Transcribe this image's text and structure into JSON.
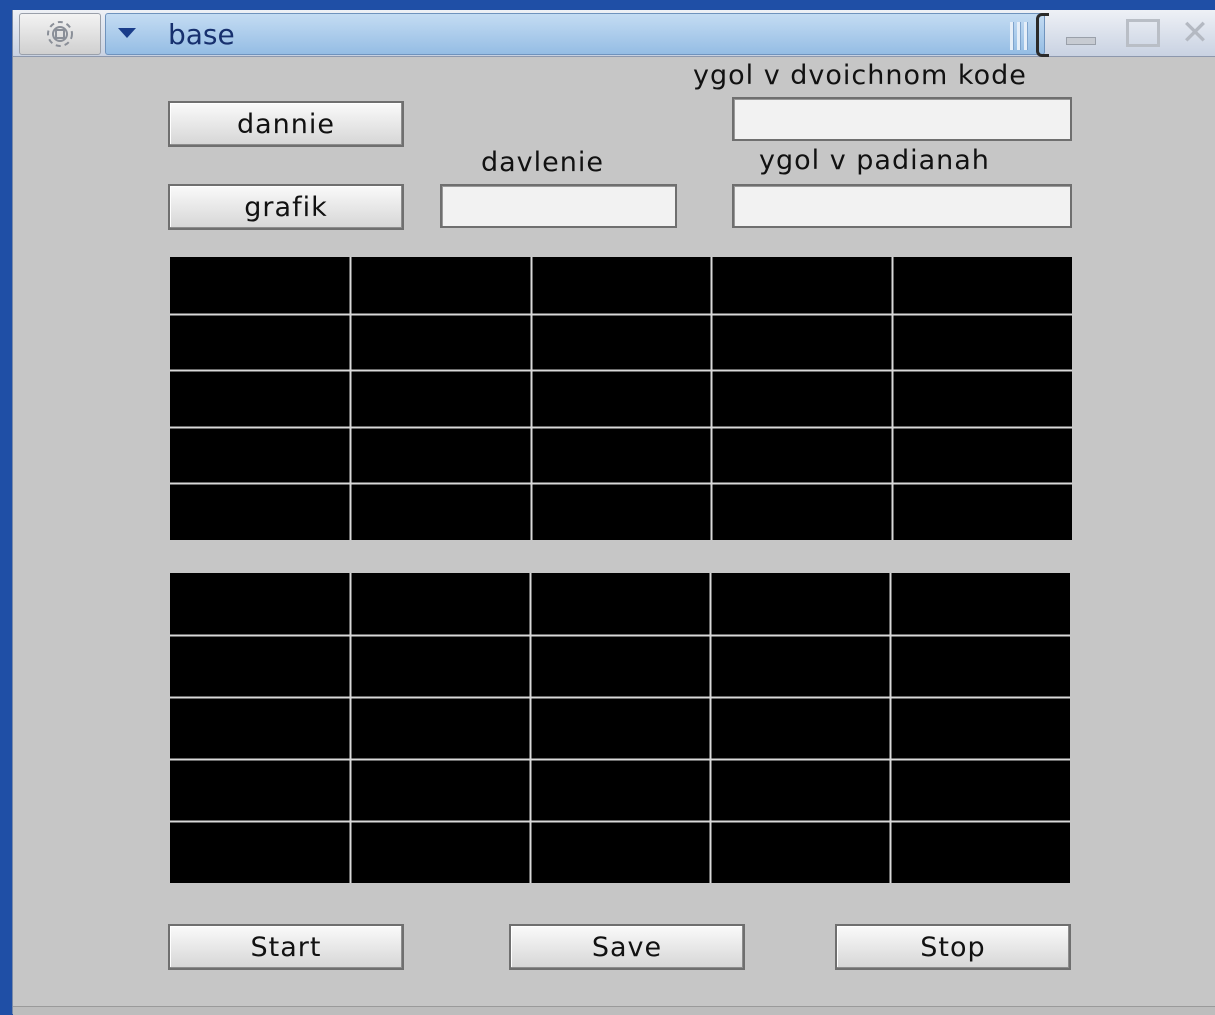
{
  "window": {
    "title": "base",
    "menu_icon": "chevron-down-icon",
    "gear_icon": "gear-icon",
    "controls": [
      "minimize-icon",
      "maximize-icon",
      "close-icon"
    ],
    "close_glyph": "✕"
  },
  "buttons": {
    "dannie": "dannie",
    "grafik": "grafik",
    "start": "Start",
    "save": "Save",
    "stop": "Stop"
  },
  "labels": {
    "binary_angle": "ygol v dvoichnom kode",
    "pressure": "davlenie",
    "radian_angle": "ygol v padianah"
  },
  "fields": {
    "binary_angle": "",
    "pressure": "",
    "radian_angle": ""
  },
  "plots": {
    "columns": 5,
    "rows": 5,
    "background": "#000000",
    "grid_color": "#d9d9d9"
  }
}
